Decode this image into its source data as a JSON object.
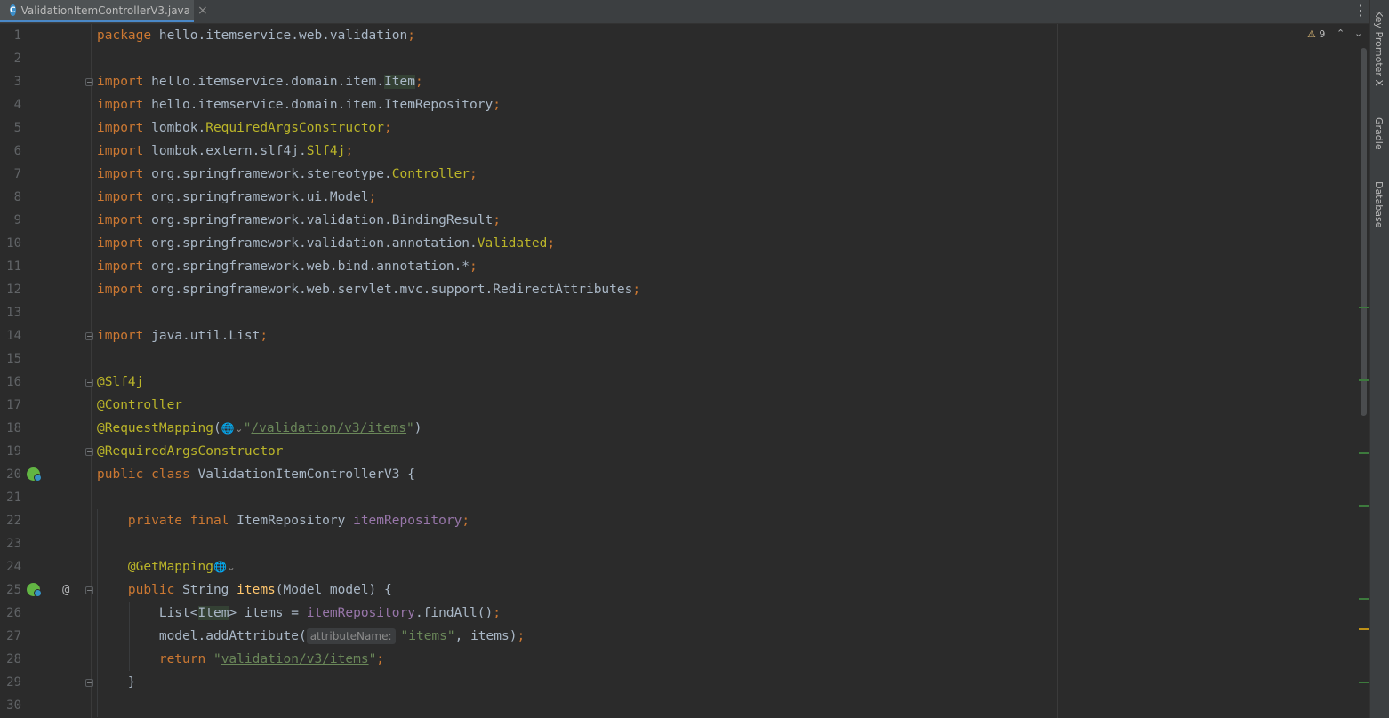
{
  "tab": {
    "icon_letter": "C",
    "filename": "ValidationItemControllerV3.java",
    "close": "×"
  },
  "toolbar": {
    "more": "⋮"
  },
  "inspections": {
    "warning_count": "9",
    "up": "⌃",
    "down": "⌄"
  },
  "toolwindows": [
    "Key Promoter X",
    "Gradle",
    "Database"
  ],
  "lines": [
    {
      "n": "1",
      "tokens": [
        [
          "kw",
          "package "
        ],
        [
          "",
          "hello.itemservice.web.validation"
        ],
        [
          "semi",
          ";"
        ]
      ]
    },
    {
      "n": "2",
      "tokens": []
    },
    {
      "n": "3",
      "tokens": [
        [
          "kw",
          "import "
        ],
        [
          "",
          "hello.itemservice.domain.item."
        ],
        [
          "cls-hl",
          "Item"
        ],
        [
          "semi",
          ";"
        ]
      ]
    },
    {
      "n": "4",
      "tokens": [
        [
          "kw",
          "import "
        ],
        [
          "",
          "hello.itemservice.domain.item.ItemRepository"
        ],
        [
          "semi",
          ";"
        ]
      ]
    },
    {
      "n": "5",
      "tokens": [
        [
          "kw",
          "import "
        ],
        [
          "",
          "lombok."
        ],
        [
          "ann",
          "RequiredArgsConstructor"
        ],
        [
          "semi",
          ";"
        ]
      ]
    },
    {
      "n": "6",
      "tokens": [
        [
          "kw",
          "import "
        ],
        [
          "",
          "lombok.extern.slf4j."
        ],
        [
          "ann",
          "Slf4j"
        ],
        [
          "semi",
          ";"
        ]
      ]
    },
    {
      "n": "7",
      "tokens": [
        [
          "kw",
          "import "
        ],
        [
          "",
          "org.springframework.stereotype."
        ],
        [
          "ann",
          "Controller"
        ],
        [
          "semi",
          ";"
        ]
      ]
    },
    {
      "n": "8",
      "tokens": [
        [
          "kw",
          "import "
        ],
        [
          "",
          "org.springframework.ui.Model"
        ],
        [
          "semi",
          ";"
        ]
      ]
    },
    {
      "n": "9",
      "tokens": [
        [
          "kw",
          "import "
        ],
        [
          "",
          "org.springframework.validation.BindingResult"
        ],
        [
          "semi",
          ";"
        ]
      ]
    },
    {
      "n": "10",
      "tokens": [
        [
          "kw",
          "import "
        ],
        [
          "",
          "org.springframework.validation.annotation."
        ],
        [
          "ann",
          "Validated"
        ],
        [
          "semi",
          ";"
        ]
      ]
    },
    {
      "n": "11",
      "tokens": [
        [
          "kw",
          "import "
        ],
        [
          "",
          "org.springframework.web.bind.annotation.*"
        ],
        [
          "semi",
          ";"
        ]
      ]
    },
    {
      "n": "12",
      "tokens": [
        [
          "kw",
          "import "
        ],
        [
          "",
          "org.springframework.web.servlet.mvc.support.RedirectAttributes"
        ],
        [
          "semi",
          ";"
        ]
      ]
    },
    {
      "n": "13",
      "tokens": []
    },
    {
      "n": "14",
      "tokens": [
        [
          "kw",
          "import "
        ],
        [
          "",
          "java.util.List"
        ],
        [
          "semi",
          ";"
        ]
      ]
    },
    {
      "n": "15",
      "tokens": []
    },
    {
      "n": "16",
      "tokens": [
        [
          "ann",
          "@Slf4j"
        ]
      ]
    },
    {
      "n": "17",
      "tokens": [
        [
          "ann",
          "@Controller"
        ]
      ]
    },
    {
      "n": "18",
      "tokens": [
        [
          "ann",
          "@RequestMapping"
        ],
        [
          "",
          "("
        ],
        [
          "globe",
          "🌐⌄"
        ],
        [
          "str-q",
          "\""
        ],
        [
          "str-link",
          "/validation/v3/items"
        ],
        [
          "str-q",
          "\""
        ],
        [
          "",
          ")"
        ]
      ]
    },
    {
      "n": "19",
      "tokens": [
        [
          "ann",
          "@RequiredArgsConstructor"
        ]
      ]
    },
    {
      "n": "20",
      "tokens": [
        [
          "kw",
          "public class "
        ],
        [
          "",
          "ValidationItemControllerV3 {"
        ]
      ]
    },
    {
      "n": "21",
      "tokens": []
    },
    {
      "n": "22",
      "tokens": [
        [
          "",
          "    "
        ],
        [
          "kw",
          "private final "
        ],
        [
          "",
          "ItemRepository "
        ],
        [
          "fld",
          "itemRepository"
        ],
        [
          "semi",
          ";"
        ]
      ]
    },
    {
      "n": "23",
      "tokens": []
    },
    {
      "n": "24",
      "tokens": [
        [
          "",
          "    "
        ],
        [
          "ann",
          "@GetMapping"
        ],
        [
          "globe",
          "🌐⌄"
        ]
      ]
    },
    {
      "n": "25",
      "tokens": [
        [
          "",
          "    "
        ],
        [
          "kw",
          "public "
        ],
        [
          "",
          "String "
        ],
        [
          "fn",
          "items"
        ],
        [
          "",
          "(Model model) {"
        ]
      ]
    },
    {
      "n": "26",
      "tokens": [
        [
          "",
          "        List<"
        ],
        [
          "cls-hl",
          "Item"
        ],
        [
          "",
          "> items = "
        ],
        [
          "fld",
          "itemRepository"
        ],
        [
          "",
          ".findAll()"
        ],
        [
          "semi",
          ";"
        ]
      ]
    },
    {
      "n": "27",
      "tokens": [
        [
          "",
          "        model.addAttribute("
        ],
        [
          "hint",
          "attributeName:"
        ],
        [
          "str",
          "\"items\""
        ],
        [
          "",
          ", items)"
        ],
        [
          "semi",
          ";"
        ]
      ]
    },
    {
      "n": "28",
      "tokens": [
        [
          "",
          "        "
        ],
        [
          "kw",
          "return "
        ],
        [
          "str-q",
          "\""
        ],
        [
          "str-link",
          "validation/v3/items"
        ],
        [
          "str-q",
          "\""
        ],
        [
          "semi",
          ";"
        ]
      ]
    },
    {
      "n": "29",
      "tokens": [
        [
          "",
          "    }"
        ]
      ]
    },
    {
      "n": "30",
      "tokens": []
    }
  ]
}
